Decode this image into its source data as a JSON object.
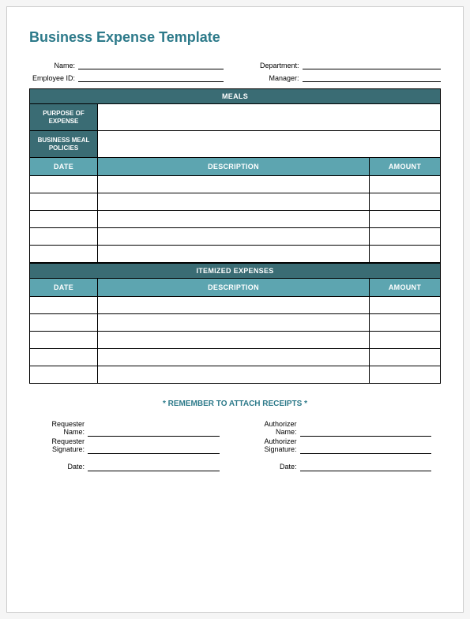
{
  "title": "Business Expense Template",
  "header": {
    "name_label": "Name:",
    "department_label": "Department:",
    "employee_id_label": "Employee ID:",
    "manager_label": "Manager:"
  },
  "meals": {
    "section_title": "MEALS",
    "purpose_label": "PURPOSE OF EXPENSE",
    "policies_label": "BUSINESS MEAL POLICIES",
    "columns": {
      "date": "DATE",
      "description": "DESCRIPTION",
      "amount": "AMOUNT"
    },
    "rows": [
      {
        "date": "",
        "description": "",
        "amount": ""
      },
      {
        "date": "",
        "description": "",
        "amount": ""
      },
      {
        "date": "",
        "description": "",
        "amount": ""
      },
      {
        "date": "",
        "description": "",
        "amount": ""
      },
      {
        "date": "",
        "description": "",
        "amount": ""
      }
    ]
  },
  "itemized": {
    "section_title": "ITEMIZED EXPENSES",
    "columns": {
      "date": "DATE",
      "description": "DESCRIPTION",
      "amount": "AMOUNT"
    },
    "rows": [
      {
        "date": "",
        "description": "",
        "amount": ""
      },
      {
        "date": "",
        "description": "",
        "amount": ""
      },
      {
        "date": "",
        "description": "",
        "amount": ""
      },
      {
        "date": "",
        "description": "",
        "amount": ""
      },
      {
        "date": "",
        "description": "",
        "amount": ""
      }
    ]
  },
  "reminder": "* REMEMBER TO ATTACH RECEIPTS *",
  "signatures": {
    "requester_name_label": "Requester Name:",
    "requester_signature_label": "Requester Signature:",
    "authorizer_name_label": "Authorizer Name:",
    "authorizer_signature_label": "Authorizer Signature:",
    "date_label": "Date:"
  }
}
